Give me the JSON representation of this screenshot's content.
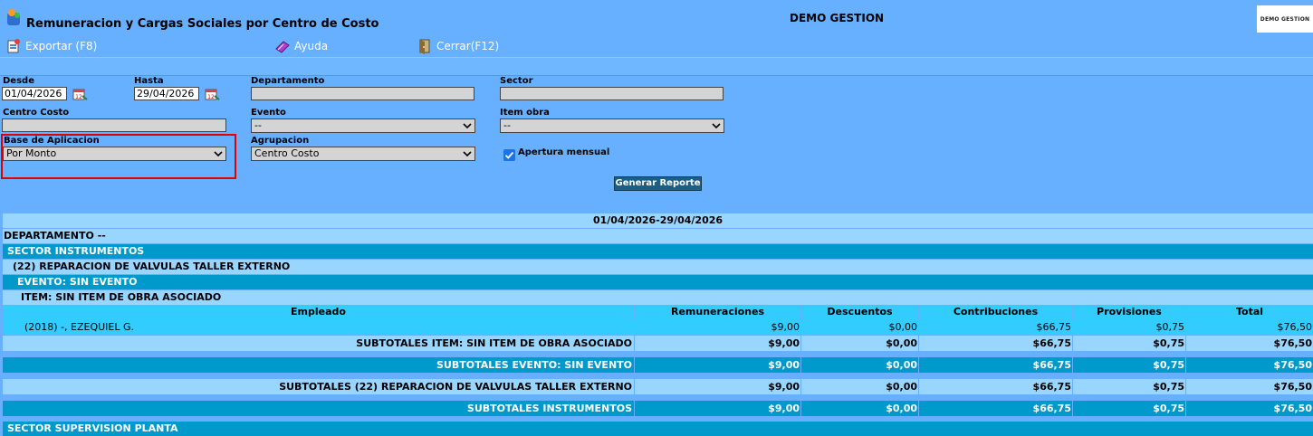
{
  "window": {
    "title": "Remuneracion y Cargas Sociales por Centro de Costo",
    "company": "DEMO GESTION",
    "logo_text": "DEMO GESTION"
  },
  "toolbar": {
    "export": "Exportar (F8)",
    "help": "Ayuda",
    "close": "Cerrar(F12)"
  },
  "filters": {
    "desde_label": "Desde",
    "desde_value": "01/04/2026",
    "hasta_label": "Hasta",
    "hasta_value": "29/04/2026",
    "departamento_label": "Departamento",
    "departamento_value": "",
    "sector_label": "Sector",
    "sector_value": "",
    "centro_costo_label": "Centro Costo",
    "centro_costo_value": "",
    "evento_label": "Evento",
    "evento_value": "--",
    "item_obra_label": "Item obra",
    "item_obra_value": "--",
    "base_label": "Base de Aplicacion",
    "base_value": "Por Monto",
    "agrupacion_label": "Agrupacion",
    "agrupacion_value": "Centro Costo",
    "apertura_label": "Apertura mensual",
    "apertura_checked": true,
    "generate_label": "Generar Reporte"
  },
  "report": {
    "period": "01/04/2026-29/04/2026",
    "departamento": "DEPARTAMENTO --",
    "sector": "SECTOR INSTRUMENTOS",
    "centro": "(22) REPARACION DE VALVULAS TALLER EXTERNO",
    "evento": "EVENTO: SIN EVENTO",
    "item": "ITEM: SIN ITEM DE OBRA ASOCIADO",
    "columns": [
      "Empleado",
      "Remuneraciones",
      "Descuentos",
      "Contribuciones",
      "Provisiones",
      "Total"
    ],
    "employee": {
      "name": "(2018) -, EZEQUIEL G.",
      "values": [
        "$9,00",
        "$0,00",
        "$66,75",
        "$0,75",
        "$76,50"
      ]
    },
    "subtotals": [
      {
        "label": "SUBTOTALES ITEM: SIN ITEM DE OBRA ASOCIADO",
        "values": [
          "$9,00",
          "$0,00",
          "$66,75",
          "$0,75",
          "$76,50"
        ]
      },
      {
        "label": "SUBTOTALES EVENTO: SIN EVENTO",
        "values": [
          "$9,00",
          "$0,00",
          "$66,75",
          "$0,75",
          "$76,50"
        ]
      },
      {
        "label": "SUBTOTALES (22) REPARACION DE VALVULAS TALLER EXTERNO",
        "values": [
          "$9,00",
          "$0,00",
          "$66,75",
          "$0,75",
          "$76,50"
        ]
      },
      {
        "label": "SUBTOTALES INSTRUMENTOS",
        "values": [
          "$9,00",
          "$0,00",
          "$66,75",
          "$0,75",
          "$76,50"
        ]
      }
    ],
    "next_sector": "SECTOR SUPERVISION PLANTA"
  },
  "colors": {
    "bg": "#66b0ff",
    "light_row": "#99d6ff",
    "teal_row": "#0099cc",
    "mid_row": "#33ccff",
    "highlight": "#e00000"
  }
}
